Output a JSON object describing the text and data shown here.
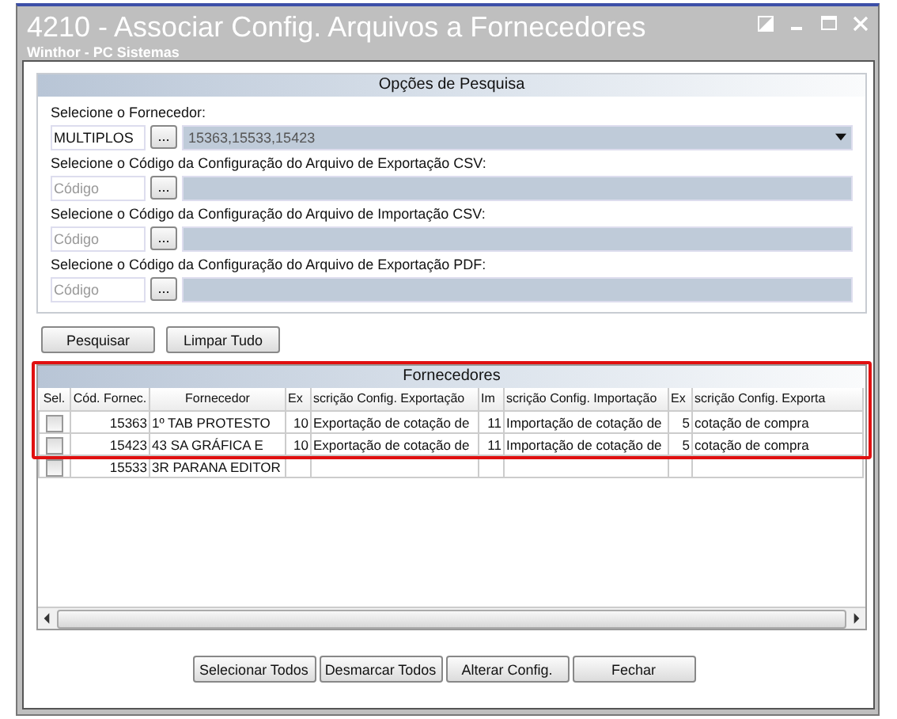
{
  "window": {
    "title": "4210 - Associar Config. Arquivos a Fornecedores",
    "subtitle": "Winthor - PC Sistemas"
  },
  "search_options": {
    "title": "Opções de Pesquisa",
    "fields": [
      {
        "kind": "dropdown",
        "label": "Selecione o Fornecedor:",
        "code": "MULTIPLOS",
        "description": "15363,15533,15423"
      },
      {
        "kind": "lookup",
        "label": "Selecione o Código da Configuração do Arquivo de Exportação CSV:",
        "code_placeholder": "Código"
      },
      {
        "kind": "lookup",
        "label": "Selecione o Código da Configuração do Arquivo de Importação CSV:",
        "code_placeholder": "Código"
      },
      {
        "kind": "lookup",
        "label": "Selecione o Código da Configuração do Arquivo de Exportação PDF:",
        "code_placeholder": "Código"
      }
    ],
    "lookup_button": "...",
    "buttons": [
      "Pesquisar",
      "Limpar Tudo"
    ]
  },
  "grid": {
    "title": "Fornecedores",
    "checkbox_column": "Sel.",
    "columns": [
      "Cód. Fornec.",
      "Fornecedor",
      "Ex",
      "scrição Config. Exportação",
      "Im",
      "scrição Config. Importação",
      "Ex",
      "scrição Config. Exporta"
    ],
    "rows": [
      {
        "checked": false,
        "cells": [
          "15363",
          "1º TAB PROTESTO",
          "10",
          "Exportação de cotação de",
          "11",
          "Importação de cotação de",
          "5",
          "cotação de compra"
        ]
      },
      {
        "checked": false,
        "cells": [
          "15423",
          "43 SA GRÁFICA E",
          "10",
          "Exportação de cotação de",
          "11",
          "Importação de cotação de",
          "5",
          "cotação de compra"
        ]
      },
      {
        "checked": false,
        "cells": [
          "15533",
          "3R PARANA EDITOR",
          "",
          "",
          "",
          "",
          "",
          ""
        ]
      }
    ]
  },
  "footer_buttons": [
    "Selecionar Todos",
    "Desmarcar Todos",
    "Alterar Config.",
    "Fechar"
  ]
}
